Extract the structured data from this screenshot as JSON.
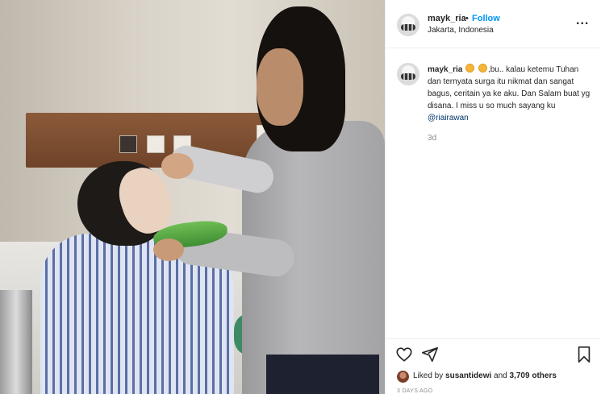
{
  "post": {
    "username": "mayk_ria",
    "dot": "•",
    "follow_label": "Follow",
    "location": "Jakarta, Indonesia",
    "more_label": "...",
    "caption": {
      "username": "mayk_ria",
      "text_part1": ",bu.. kalau ketemu Tuhan dan ternyata surga itu nikmat dan sangat bagus, ceritain ya ke aku. Dan Salam buat yg disana. I miss u so much sayang ku ",
      "mention": "@riairawan",
      "emoji": [
        "smiling-face-with-heart-eyes-icon",
        "smiling-face-with-heart-eyes-icon"
      ]
    },
    "age": "3d",
    "likes": {
      "prefix": "Liked by ",
      "user": "susantidewi",
      "and": " and ",
      "others": "3,709 others"
    },
    "timestamp": "3 DAYS AGO"
  },
  "colors": {
    "accent": "#0095f6",
    "mention": "#00376b",
    "muted": "#8e8e8e",
    "text": "#262626",
    "border": "#efefef"
  },
  "icons": [
    "heart-icon",
    "share-icon",
    "bookmark-icon",
    "more-options-icon"
  ]
}
